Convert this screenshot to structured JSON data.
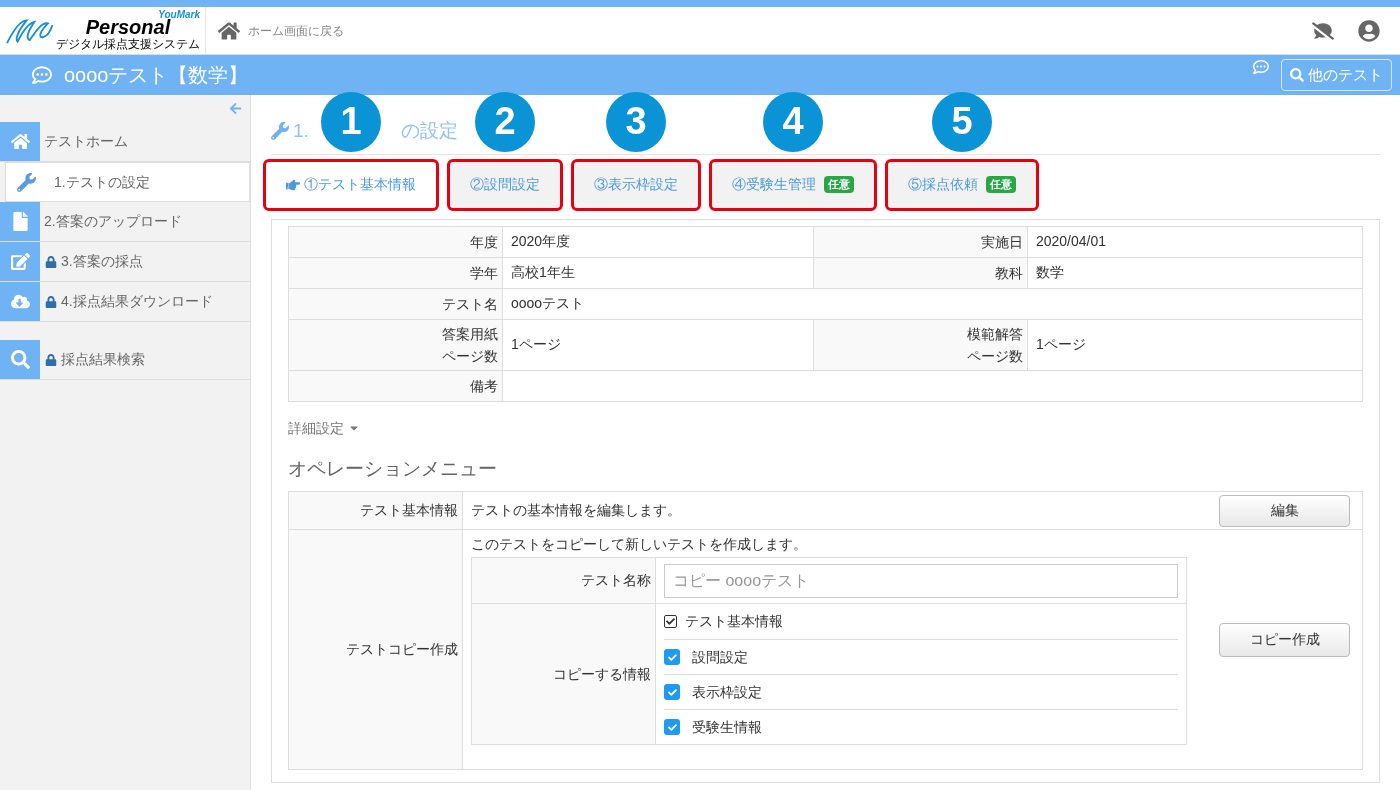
{
  "logo": {
    "brand": "YouMark",
    "name": "Personal",
    "tagline": "デジタル採点支援システム"
  },
  "header": {
    "home_link": "ホーム画面に戻る"
  },
  "title_bar": {
    "title": "ooooテスト【数学】",
    "other_tests_button": "他のテスト"
  },
  "sidebar": {
    "items": [
      {
        "label": "テストホーム",
        "locked": false,
        "selected": false
      },
      {
        "label": "1.テストの設定",
        "locked": false,
        "selected": true
      },
      {
        "label": "2.答案のアップロード",
        "locked": false,
        "selected": false
      },
      {
        "label": "3.答案の採点",
        "locked": true,
        "selected": false
      },
      {
        "label": "4.採点結果ダウンロード",
        "locked": true,
        "selected": false
      },
      {
        "label": "採点結果検索",
        "locked": true,
        "selected": false
      }
    ]
  },
  "page_title": {
    "visible_start": "1.",
    "visible_end": "の設定"
  },
  "tabs": [
    {
      "label": "①テスト基本情報",
      "selected": true,
      "marker": "1"
    },
    {
      "label": "②設問設定",
      "selected": false,
      "marker": "2"
    },
    {
      "label": "③表示枠設定",
      "selected": false,
      "marker": "3"
    },
    {
      "label": "④受験生管理",
      "badge": "任意",
      "selected": false,
      "marker": "4"
    },
    {
      "label": "⑤採点依頼",
      "badge": "任意",
      "selected": false,
      "marker": "5"
    }
  ],
  "info_table": {
    "rows": [
      {
        "cells": [
          {
            "label": "年度",
            "value": "2020年度"
          },
          {
            "label": "実施日",
            "value": "2020/04/01"
          }
        ]
      },
      {
        "cells": [
          {
            "label": "学年",
            "value": "高校1年生"
          },
          {
            "label": "教科",
            "value": "数学"
          }
        ]
      },
      {
        "cells": [
          {
            "label": "テスト名",
            "value": "ooooテスト"
          }
        ]
      },
      {
        "cells": [
          {
            "label": "答案用紙ページ数",
            "value": "1ページ"
          },
          {
            "label": "模範解答ページ数",
            "value": "1ページ"
          }
        ]
      },
      {
        "cells": [
          {
            "label": "備考"
          }
        ]
      }
    ]
  },
  "details_toggle": "詳細設定",
  "operation_menu": {
    "heading": "オペレーションメニュー",
    "edit_row": {
      "label": "テスト基本情報",
      "description": "テストの基本情報を編集します。",
      "button": "編集"
    },
    "copy_row": {
      "label": "テストコピー作成",
      "description": "このテストをコピーして新しいテストを作成します。",
      "name_label": "テスト名称",
      "name_placeholder": "コピー ooooテスト",
      "info_label": "コピーする情報",
      "button": "コピー作成",
      "options": [
        {
          "label": "テスト基本情報",
          "checked": true,
          "disabled": true
        },
        {
          "label": "設問設定",
          "checked": true,
          "disabled": false
        },
        {
          "label": "表示枠設定",
          "checked": true,
          "disabled": false
        },
        {
          "label": "受験生情報",
          "checked": true,
          "disabled": false
        }
      ]
    }
  }
}
